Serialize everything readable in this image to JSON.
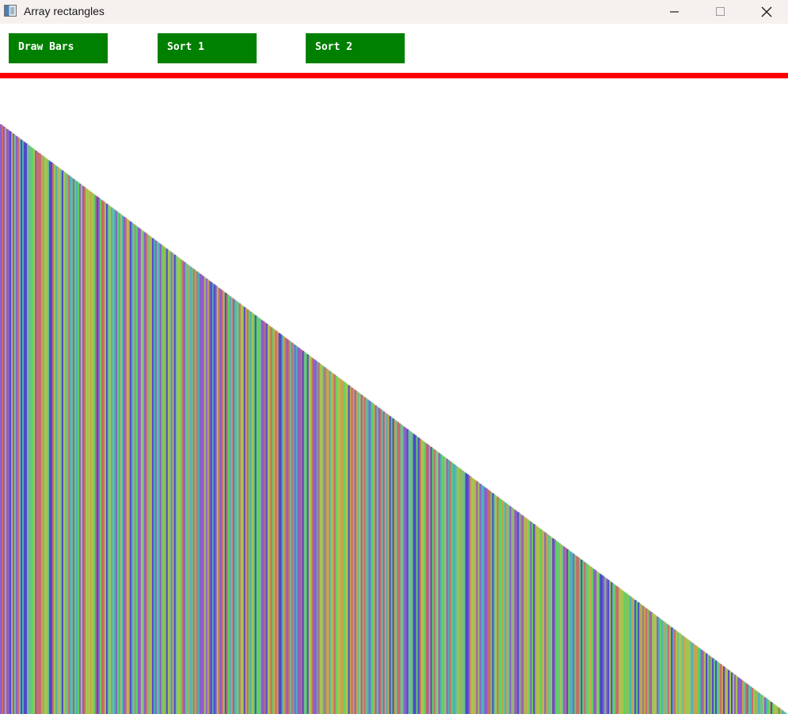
{
  "window": {
    "title": "Array rectangles",
    "controls": [
      "minimize",
      "maximize",
      "close"
    ]
  },
  "toolbar": {
    "buttons": [
      {
        "label": "Draw Bars"
      },
      {
        "label": "Sort 1"
      },
      {
        "label": "Sort 2"
      }
    ],
    "button_color": "#008000",
    "button_text_color": "#ffffff"
  },
  "divider": {
    "color": "#ff0000"
  },
  "bars": {
    "count": 498,
    "order": "descending (sorted)",
    "max_fraction": 1.0,
    "min_fraction": 0.0,
    "palette": [
      "#5fd35f",
      "#4f49c9",
      "#c96b6b",
      "#a8c44f",
      "#4fb0b8",
      "#8c5fc9",
      "#6fbf8f",
      "#c9a24f"
    ]
  }
}
